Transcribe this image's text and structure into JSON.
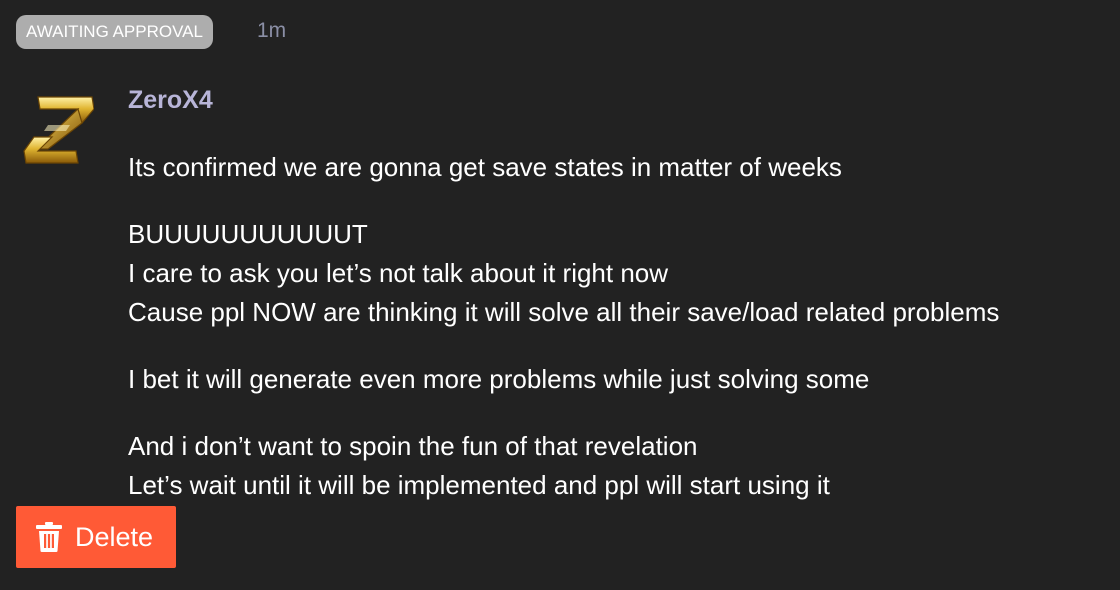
{
  "post": {
    "status_badge": "AWAITING APPROVAL",
    "timestamp": "1m",
    "author": "ZeroX4",
    "avatar_icon": "zero-x4-logo-icon",
    "paragraphs": [
      [
        "Its confirmed we are gonna get save states in matter of weeks"
      ],
      [
        "BUUUUUUUUUUUT",
        "I care to ask you let’s not talk about it right now",
        "Cause ppl NOW are thinking it will solve all their save/load related problems"
      ],
      [
        "I bet it will generate even more problems while just solving some"
      ],
      [
        "And i don’t want to spoin the fun of that revelation",
        "Let’s wait until it will be implemented and ppl will start using it"
      ]
    ]
  },
  "actions": {
    "delete_label": "Delete",
    "delete_icon": "trash-icon"
  },
  "colors": {
    "background": "#222222",
    "badge_bg": "#adadad",
    "author": "#b8b5d8",
    "timestamp": "#8b8fa6",
    "delete_button": "#ff5a36"
  }
}
